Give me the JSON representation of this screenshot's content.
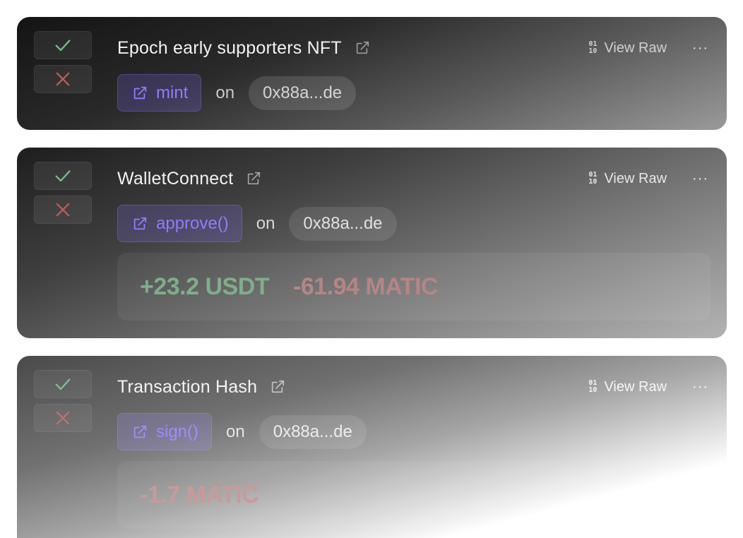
{
  "colors": {
    "approve_green": "#6fbf8a",
    "reject_red": "#c05a5a",
    "method_purple": "#8f7cff"
  },
  "icons": {
    "approve": "check-icon",
    "reject": "x-icon",
    "external": "external-link-icon",
    "raw": "binary-icon",
    "more": "ellipsis-icon"
  },
  "requests": [
    {
      "title": "Epoch early supporters NFT",
      "view_raw_label": "View Raw",
      "bin_top": "01",
      "bin_bottom": "10",
      "more_label": "···",
      "method": "mint",
      "on_label": "on",
      "address": "0x88a...de",
      "balances": []
    },
    {
      "title": "WalletConnect",
      "view_raw_label": "View Raw",
      "bin_top": "01",
      "bin_bottom": "10",
      "more_label": "···",
      "method": "approve()",
      "on_label": "on",
      "address": "0x88a...de",
      "balances": [
        "+23.2 USDT",
        "-61.94 MATIC"
      ]
    },
    {
      "title": "Transaction Hash",
      "view_raw_label": "View Raw",
      "bin_top": "01",
      "bin_bottom": "10",
      "more_label": "···",
      "method": "sign()",
      "on_label": "on",
      "address": "0x88a...de",
      "balances": [
        "-1.7 MATIC"
      ]
    }
  ]
}
